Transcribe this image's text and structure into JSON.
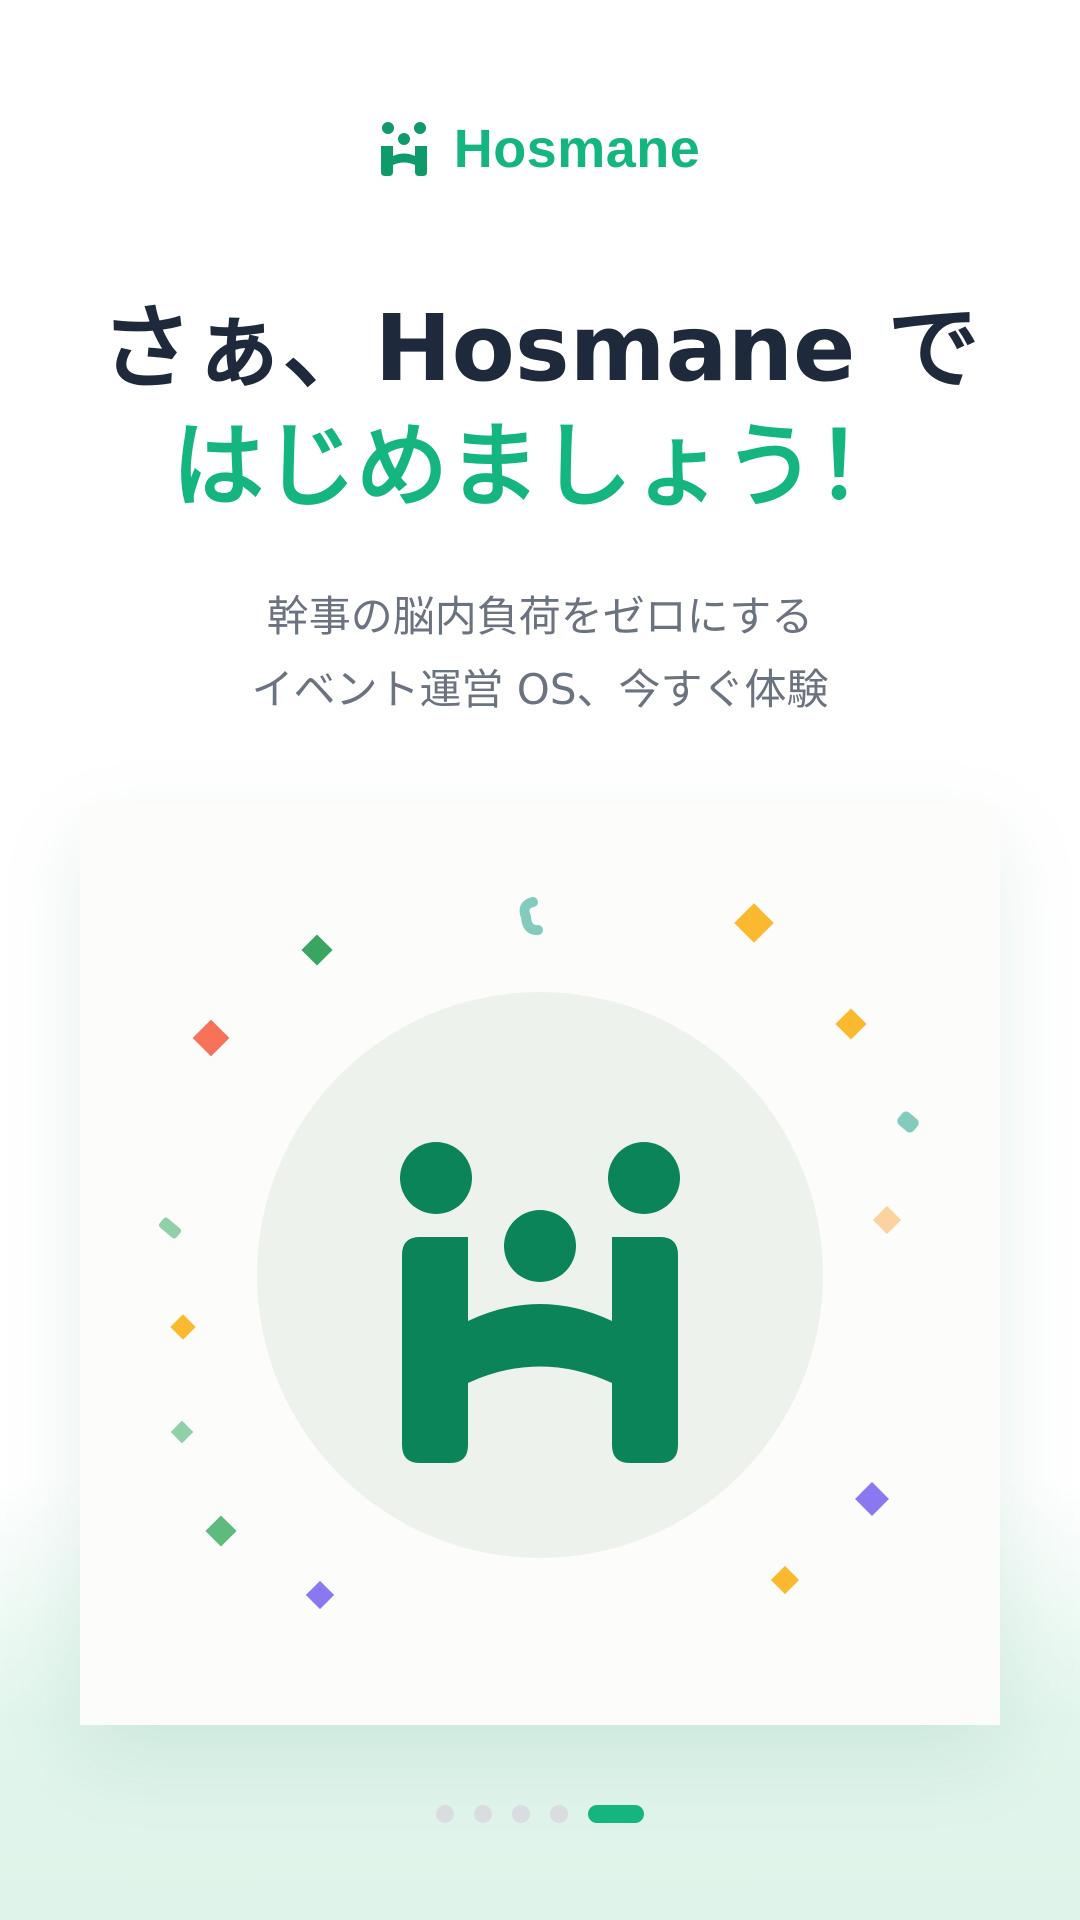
{
  "brand": {
    "name": "Hosmane",
    "logo_icon": "hosmane-logo-icon",
    "color": "#14b57f"
  },
  "headline": {
    "line1": "さぁ、Hosmane で",
    "line2": "はじめましょう！",
    "line1_color": "#1e293b",
    "line2_color": "#14b57f"
  },
  "subtitle": {
    "line1": "幹事の脳内負荷をゼロにする",
    "line2": "イベント運営 OS、今すぐ体験"
  },
  "illustration": {
    "name": "celebration-logo-illustration",
    "logo_color": "#0a8458",
    "circle_color": "#edf3ec",
    "confetti_colors": [
      "#fbb92f",
      "#3aa561",
      "#f6735a",
      "#84cbbd",
      "#8fd0a8",
      "#fcd29e",
      "#8a78f1"
    ]
  },
  "pagination": {
    "total": 5,
    "active_index": 4,
    "active_color": "#14b57f",
    "inactive_color": "#d9dde2"
  }
}
